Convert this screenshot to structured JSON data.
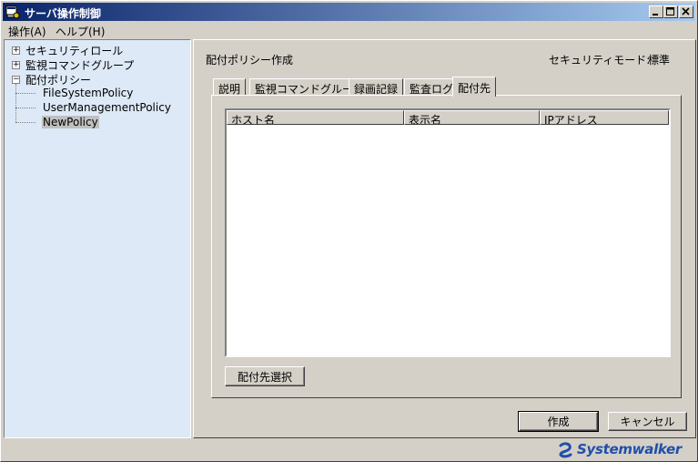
{
  "window": {
    "title": "サーバ操作制御",
    "buttons": [
      "minimize-icon",
      "maximize-icon",
      "close-icon"
    ]
  },
  "menu": {
    "items": [
      {
        "label": "操作(A)"
      },
      {
        "label": "ヘルプ(H)"
      }
    ]
  },
  "tree": {
    "nodes": [
      {
        "label": "セキュリティロール",
        "expander": "+"
      },
      {
        "label": "監視コマンドグループ",
        "expander": "+"
      },
      {
        "label": "配付ポリシー",
        "expander": "−"
      }
    ],
    "leaves": [
      {
        "label": "FileSystemPolicy"
      },
      {
        "label": "UserManagementPolicy"
      },
      {
        "label": "NewPolicy",
        "selected": true
      }
    ]
  },
  "panel": {
    "title": "配付ポリシー作成",
    "security_mode_label": "セキュリティモード:",
    "security_mode_value": "標準",
    "tabs": [
      {
        "label": "説明"
      },
      {
        "label": "監視コマンドグループ"
      },
      {
        "label": "録画記録"
      },
      {
        "label": "監査ログ"
      },
      {
        "label": "配付先",
        "active": true
      }
    ],
    "table": {
      "columns": [
        "ホスト名",
        "表示名",
        "IPアドレス"
      ],
      "rows": []
    },
    "select_button": "配付先選択"
  },
  "footer": {
    "create_button": "作成",
    "cancel_button": "キャンセル"
  },
  "brand": {
    "name": "Systemwalker",
    "color": "#1f4fa8"
  },
  "colors": {
    "title_gradient_start": "#0a246a",
    "title_gradient_end": "#a6caf0",
    "tree_background": "#dde9f7",
    "face": "#d4d0c8"
  }
}
